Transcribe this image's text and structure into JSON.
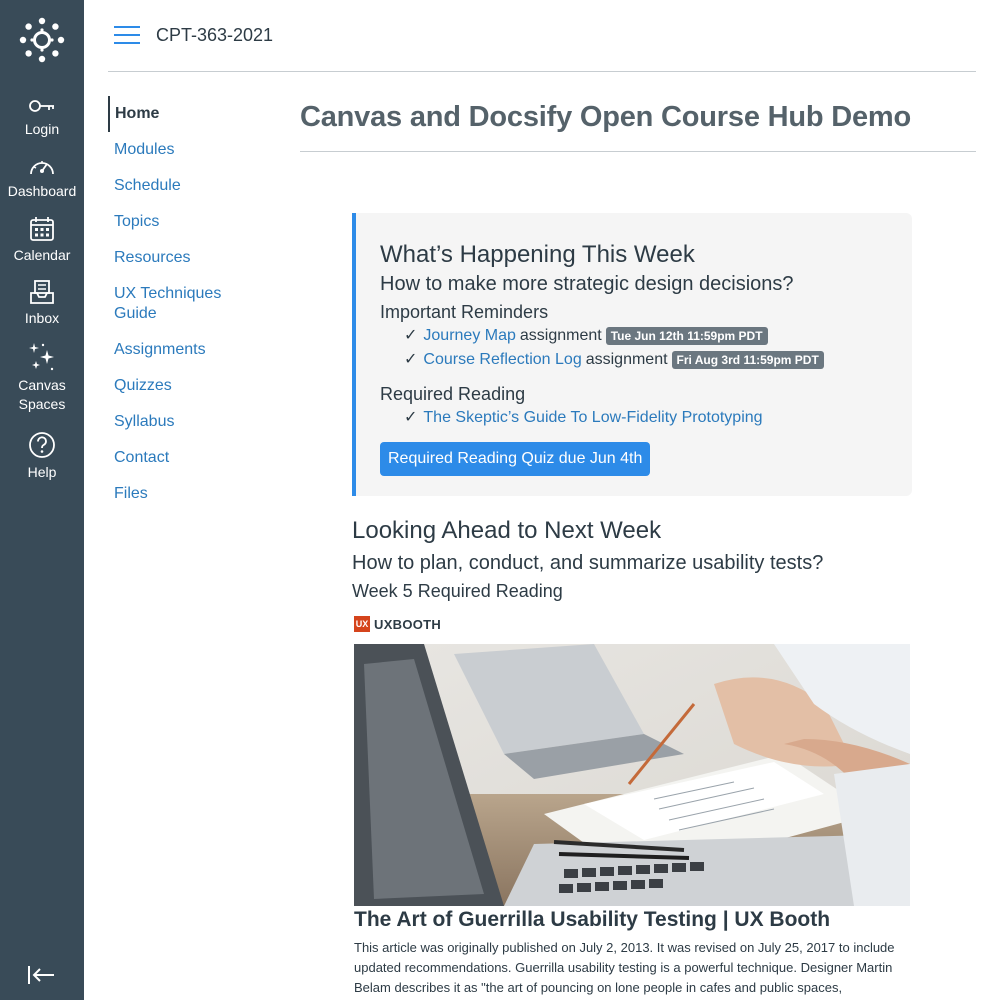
{
  "colors": {
    "global_nav_bg": "#394b58",
    "link": "#2b7abc",
    "accent": "#2d8be8",
    "text": "#2d3b45",
    "badge_bg": "#6b7780",
    "callout_bg": "#f5f5f5"
  },
  "global_nav": {
    "logo_icon": "canvas-logo-icon",
    "items": [
      {
        "label": "Login",
        "icon": "key-icon"
      },
      {
        "label": "Dashboard",
        "icon": "dashboard-gauge-icon"
      },
      {
        "label": "Calendar",
        "icon": "calendar-icon"
      },
      {
        "label": "Inbox",
        "icon": "inbox-icon"
      },
      {
        "label": "Canvas\nSpaces",
        "icon": "sparkles-icon"
      },
      {
        "label": "Help",
        "icon": "help-icon"
      }
    ],
    "collapse_icon": "collapse-arrow-icon"
  },
  "header": {
    "menu_icon": "hamburger-icon",
    "course_code": "CPT-363-2021"
  },
  "course_nav": {
    "items": [
      {
        "label": "Home",
        "active": true
      },
      {
        "label": "Modules"
      },
      {
        "label": "Schedule"
      },
      {
        "label": "Topics"
      },
      {
        "label": "Resources"
      },
      {
        "label": "UX Techniques\nGuide"
      },
      {
        "label": "Assignments"
      },
      {
        "label": "Quizzes"
      },
      {
        "label": "Syllabus"
      },
      {
        "label": "Contact"
      },
      {
        "label": "Files"
      }
    ]
  },
  "page": {
    "title": "Canvas and Docsify Open Course Hub Demo"
  },
  "this_week": {
    "heading": "What’s Happening This Week",
    "question": "How to make more strategic design decisions?",
    "reminders_heading": "Important Reminders",
    "reminders": [
      {
        "check": "✓",
        "link": "Journey Map",
        "suffix": "assignment",
        "due": "Tue Jun 12th 11:59pm PDT"
      },
      {
        "check": "✓",
        "link": "Course Reflection Log",
        "suffix": "assignment",
        "due": "Fri Aug 3rd 11:59pm PDT"
      }
    ],
    "reading_heading": "Required Reading",
    "reading": [
      {
        "check": "✓",
        "link": "The Skeptic’s Guide To Low-Fidelity Prototyping"
      }
    ],
    "quiz_button": "Required Reading Quiz due Jun 4th"
  },
  "next_week": {
    "heading": "Looking Ahead to Next Week",
    "question": "How to plan, conduct, and summarize usability tests?",
    "reading_heading": "Week 5 Required Reading",
    "source_logo_text": "UX",
    "source_name": "UXBOOTH",
    "article_title": "The Art of Guerrilla Usability Testing | UX Booth",
    "article_desc": "This article was originally published on July 2, 2013. It was revised on July 25, 2017 to include updated recommendations. Guerrilla usability testing is a powerful technique. Designer Martin Belam describes it as \"the art of pouncing on lone people in cafes and public spaces,"
  }
}
